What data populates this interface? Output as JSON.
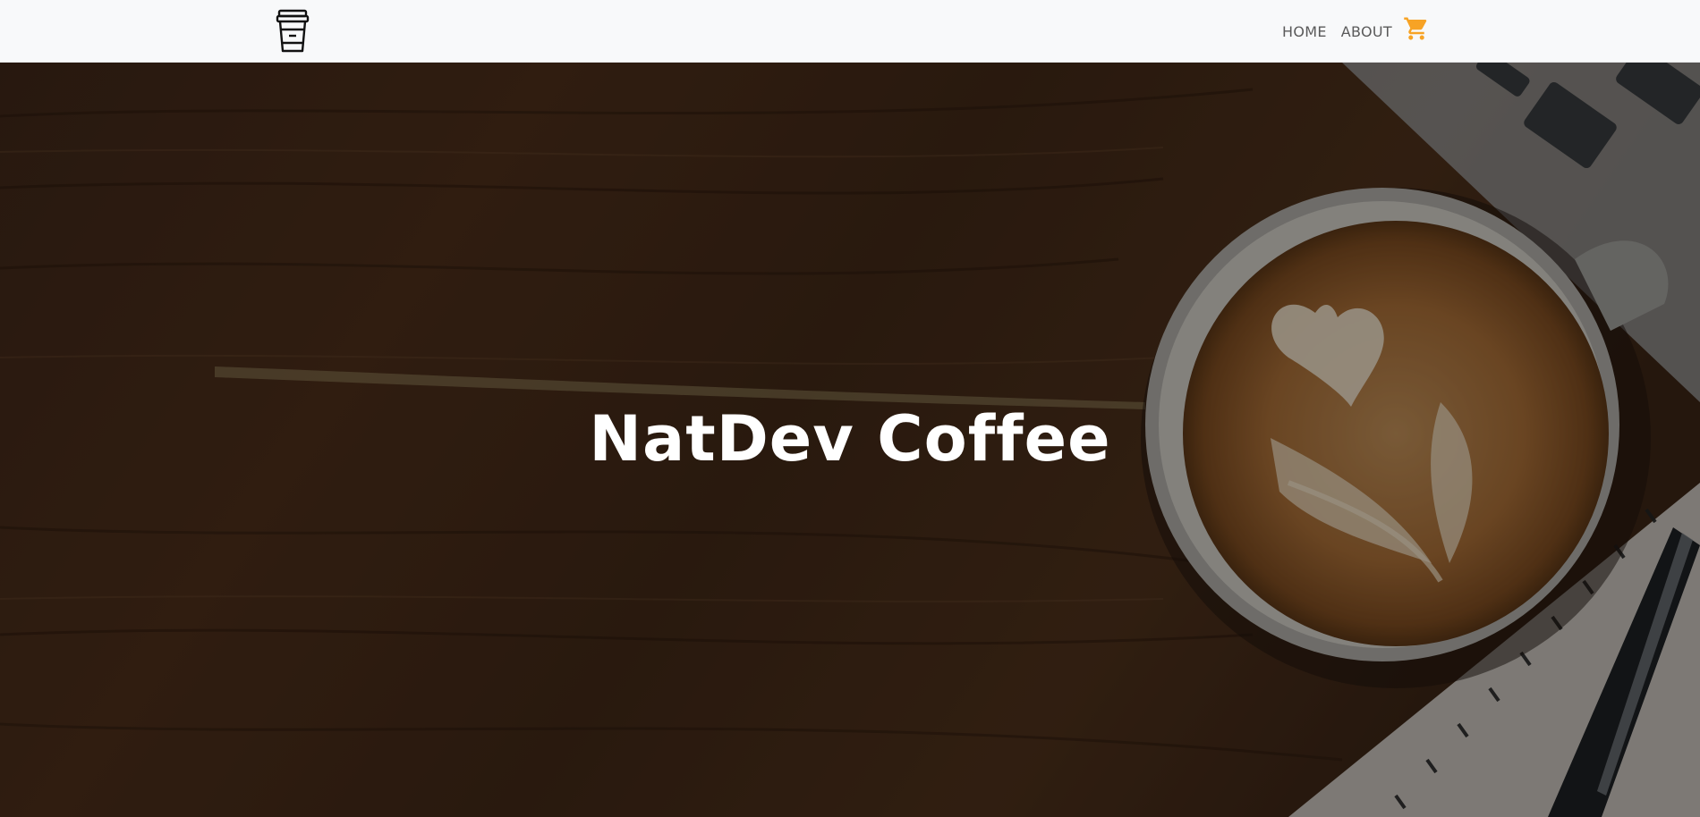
{
  "navbar": {
    "logo_icon": "coffee-cup-icon",
    "links": [
      {
        "label": "HOME"
      },
      {
        "label": "ABOUT"
      }
    ],
    "cart_icon": "shopping-cart-icon",
    "cart_color": "#f7a325"
  },
  "hero": {
    "title": "NatDev Coffee",
    "background": "wooden table with latte art coffee cup, laptop keyboard and notebook with pen"
  },
  "colors": {
    "navbar_bg": "#f8f9fa",
    "nav_text": "#5a5a5a",
    "accent": "#f7a325",
    "hero_text": "#ffffff"
  }
}
